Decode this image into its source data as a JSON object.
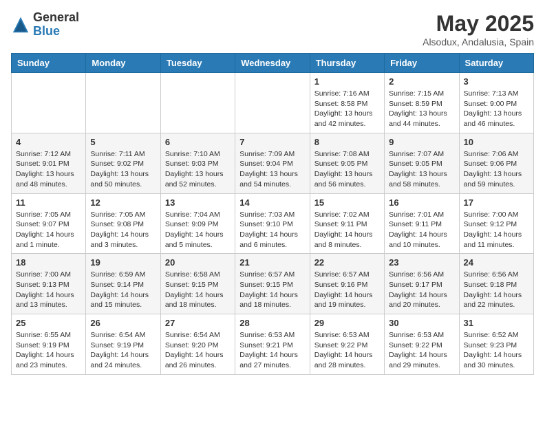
{
  "logo": {
    "general": "General",
    "blue": "Blue"
  },
  "title": "May 2025",
  "subtitle": "Alsodux, Andalusia, Spain",
  "days_of_week": [
    "Sunday",
    "Monday",
    "Tuesday",
    "Wednesday",
    "Thursday",
    "Friday",
    "Saturday"
  ],
  "weeks": [
    [
      {
        "day": "",
        "info": ""
      },
      {
        "day": "",
        "info": ""
      },
      {
        "day": "",
        "info": ""
      },
      {
        "day": "",
        "info": ""
      },
      {
        "day": "1",
        "info": "Sunrise: 7:16 AM\nSunset: 8:58 PM\nDaylight: 13 hours\nand 42 minutes."
      },
      {
        "day": "2",
        "info": "Sunrise: 7:15 AM\nSunset: 8:59 PM\nDaylight: 13 hours\nand 44 minutes."
      },
      {
        "day": "3",
        "info": "Sunrise: 7:13 AM\nSunset: 9:00 PM\nDaylight: 13 hours\nand 46 minutes."
      }
    ],
    [
      {
        "day": "4",
        "info": "Sunrise: 7:12 AM\nSunset: 9:01 PM\nDaylight: 13 hours\nand 48 minutes."
      },
      {
        "day": "5",
        "info": "Sunrise: 7:11 AM\nSunset: 9:02 PM\nDaylight: 13 hours\nand 50 minutes."
      },
      {
        "day": "6",
        "info": "Sunrise: 7:10 AM\nSunset: 9:03 PM\nDaylight: 13 hours\nand 52 minutes."
      },
      {
        "day": "7",
        "info": "Sunrise: 7:09 AM\nSunset: 9:04 PM\nDaylight: 13 hours\nand 54 minutes."
      },
      {
        "day": "8",
        "info": "Sunrise: 7:08 AM\nSunset: 9:05 PM\nDaylight: 13 hours\nand 56 minutes."
      },
      {
        "day": "9",
        "info": "Sunrise: 7:07 AM\nSunset: 9:05 PM\nDaylight: 13 hours\nand 58 minutes."
      },
      {
        "day": "10",
        "info": "Sunrise: 7:06 AM\nSunset: 9:06 PM\nDaylight: 13 hours\nand 59 minutes."
      }
    ],
    [
      {
        "day": "11",
        "info": "Sunrise: 7:05 AM\nSunset: 9:07 PM\nDaylight: 14 hours\nand 1 minute."
      },
      {
        "day": "12",
        "info": "Sunrise: 7:05 AM\nSunset: 9:08 PM\nDaylight: 14 hours\nand 3 minutes."
      },
      {
        "day": "13",
        "info": "Sunrise: 7:04 AM\nSunset: 9:09 PM\nDaylight: 14 hours\nand 5 minutes."
      },
      {
        "day": "14",
        "info": "Sunrise: 7:03 AM\nSunset: 9:10 PM\nDaylight: 14 hours\nand 6 minutes."
      },
      {
        "day": "15",
        "info": "Sunrise: 7:02 AM\nSunset: 9:11 PM\nDaylight: 14 hours\nand 8 minutes."
      },
      {
        "day": "16",
        "info": "Sunrise: 7:01 AM\nSunset: 9:11 PM\nDaylight: 14 hours\nand 10 minutes."
      },
      {
        "day": "17",
        "info": "Sunrise: 7:00 AM\nSunset: 9:12 PM\nDaylight: 14 hours\nand 11 minutes."
      }
    ],
    [
      {
        "day": "18",
        "info": "Sunrise: 7:00 AM\nSunset: 9:13 PM\nDaylight: 14 hours\nand 13 minutes."
      },
      {
        "day": "19",
        "info": "Sunrise: 6:59 AM\nSunset: 9:14 PM\nDaylight: 14 hours\nand 15 minutes."
      },
      {
        "day": "20",
        "info": "Sunrise: 6:58 AM\nSunset: 9:15 PM\nDaylight: 14 hours\nand 18 minutes."
      },
      {
        "day": "21",
        "info": "Sunrise: 6:57 AM\nSunset: 9:15 PM\nDaylight: 14 hours\nand 18 minutes."
      },
      {
        "day": "22",
        "info": "Sunrise: 6:57 AM\nSunset: 9:16 PM\nDaylight: 14 hours\nand 19 minutes."
      },
      {
        "day": "23",
        "info": "Sunrise: 6:56 AM\nSunset: 9:17 PM\nDaylight: 14 hours\nand 20 minutes."
      },
      {
        "day": "24",
        "info": "Sunrise: 6:56 AM\nSunset: 9:18 PM\nDaylight: 14 hours\nand 22 minutes."
      }
    ],
    [
      {
        "day": "25",
        "info": "Sunrise: 6:55 AM\nSunset: 9:19 PM\nDaylight: 14 hours\nand 23 minutes."
      },
      {
        "day": "26",
        "info": "Sunrise: 6:54 AM\nSunset: 9:19 PM\nDaylight: 14 hours\nand 24 minutes."
      },
      {
        "day": "27",
        "info": "Sunrise: 6:54 AM\nSunset: 9:20 PM\nDaylight: 14 hours\nand 26 minutes."
      },
      {
        "day": "28",
        "info": "Sunrise: 6:53 AM\nSunset: 9:21 PM\nDaylight: 14 hours\nand 27 minutes."
      },
      {
        "day": "29",
        "info": "Sunrise: 6:53 AM\nSunset: 9:22 PM\nDaylight: 14 hours\nand 28 minutes."
      },
      {
        "day": "30",
        "info": "Sunrise: 6:53 AM\nSunset: 9:22 PM\nDaylight: 14 hours\nand 29 minutes."
      },
      {
        "day": "31",
        "info": "Sunrise: 6:52 AM\nSunset: 9:23 PM\nDaylight: 14 hours\nand 30 minutes."
      }
    ]
  ]
}
